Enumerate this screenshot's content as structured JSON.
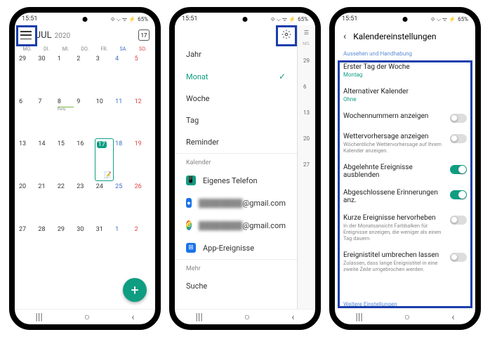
{
  "status": {
    "time": "15:51",
    "battery": "65%",
    "icons": "⟐ ⌵ ᯤ ⚡"
  },
  "screen1": {
    "month": "JUL",
    "year": "2020",
    "today_badge": "17",
    "weekdays": [
      "MO.",
      "DI.",
      "MI.",
      "DO.",
      "FR.",
      "SA.",
      "SO."
    ],
    "days": [
      [
        29,
        30,
        1,
        2,
        3,
        4,
        5
      ],
      [
        6,
        7,
        8,
        9,
        10,
        11,
        12
      ],
      [
        13,
        14,
        15,
        16,
        17,
        18,
        19
      ],
      [
        20,
        21,
        22,
        23,
        24,
        25,
        26
      ],
      [
        27,
        28,
        29,
        30,
        31,
        1,
        2
      ]
    ],
    "event_label": "Party",
    "today": 17,
    "fab": "+"
  },
  "screen2": {
    "views": [
      {
        "label": "Jahr",
        "selected": false
      },
      {
        "label": "Monat",
        "selected": true
      },
      {
        "label": "Woche",
        "selected": false
      },
      {
        "label": "Tag",
        "selected": false
      },
      {
        "label": "Reminder",
        "selected": false
      }
    ],
    "section_cal": "Kalender",
    "calendars": [
      {
        "icon": "teal",
        "glyph": "📱",
        "label": "Eigenes Telefon"
      },
      {
        "icon": "blue",
        "glyph": "●",
        "label": "@gmail.com",
        "blurred": true
      },
      {
        "icon": "multi",
        "glyph": "G",
        "label": "@gmail.com",
        "blurred": true
      },
      {
        "icon": "badge",
        "glyph": "⊞",
        "label": "App-Ereignisse"
      }
    ],
    "section_more": "Mehr",
    "suche": "Suche",
    "peek_header": "MO.",
    "peek_days": [
      29,
      6,
      13,
      20,
      27
    ]
  },
  "screen3": {
    "title": "Kalendereinstellungen",
    "section1": "Aussehen und Handhabung",
    "rows": [
      {
        "title": "Erster Tag der Woche",
        "value": "Montag",
        "toggle": null
      },
      {
        "title": "Alternativer Kalender",
        "value": "Ohne",
        "toggle": null
      },
      {
        "title": "Wochennummern anzeigen",
        "sub": null,
        "toggle": false
      },
      {
        "title": "Wettervorhersage anzeigen",
        "sub": "Wöchentliche Wettervorhersage auf Ihrem Kalender anzeigen.",
        "toggle": false
      },
      {
        "title": "Abgelehnte Ereignisse ausblenden",
        "sub": null,
        "toggle": true
      },
      {
        "title": "Abgeschlossene Erinnerungen anz.",
        "sub": null,
        "toggle": true
      },
      {
        "title": "Kurze Ereignisse hervorheben",
        "sub": "In der Monatsansicht Farbbalken für Ereignisse anzeigen, die weniger als einen Tag dauern.",
        "toggle": false
      },
      {
        "title": "Ereignistitel umbrechen lassen",
        "sub": "Zulassen, dass lange Ereignistitel in eine zweite Zeile umgebrochen werden.",
        "toggle": false
      }
    ],
    "footer": "Weitere Einstellungen"
  },
  "nav": {
    "recent": "|||",
    "home": "○",
    "back": "‹"
  }
}
